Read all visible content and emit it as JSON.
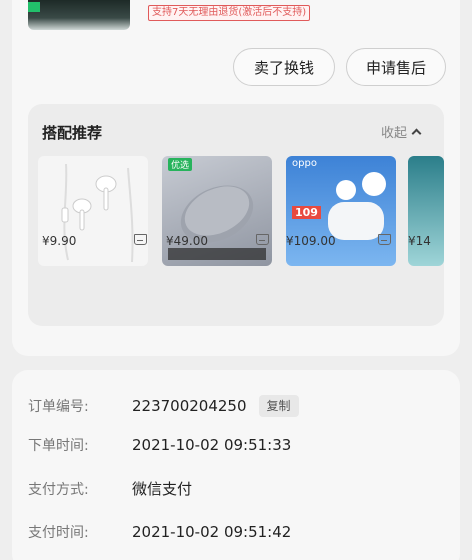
{
  "product": {
    "promo_tag": "支持7天无理由退货(激活后不支持)"
  },
  "actions": {
    "sell_label": "卖了换钱",
    "after_sales_label": "申请售后"
  },
  "recommend": {
    "title": "搭配推荐",
    "collapse_label": "收起",
    "items": [
      {
        "name": "earphones",
        "price": "¥9.90"
      },
      {
        "name": "mouse",
        "price": "¥49.00",
        "badge": "优选"
      },
      {
        "name": "earbuds",
        "price": "¥109.00",
        "brand": "oppo",
        "tag": "109"
      },
      {
        "name": "partial",
        "price": "¥14"
      }
    ]
  },
  "order": {
    "number_label": "订单编号:",
    "number_value": "223700204250",
    "copy_label": "复制",
    "created_label": "下单时间:",
    "created_value": "2021-10-02 09:51:33",
    "pay_method_label": "支付方式:",
    "pay_method_value": "微信支付",
    "paid_label": "支付时间:",
    "paid_value": "2021-10-02 09:51:42"
  },
  "colors": {
    "promo": "#e05a5a",
    "card": "#f7f7f7",
    "background": "#eeeeee"
  }
}
